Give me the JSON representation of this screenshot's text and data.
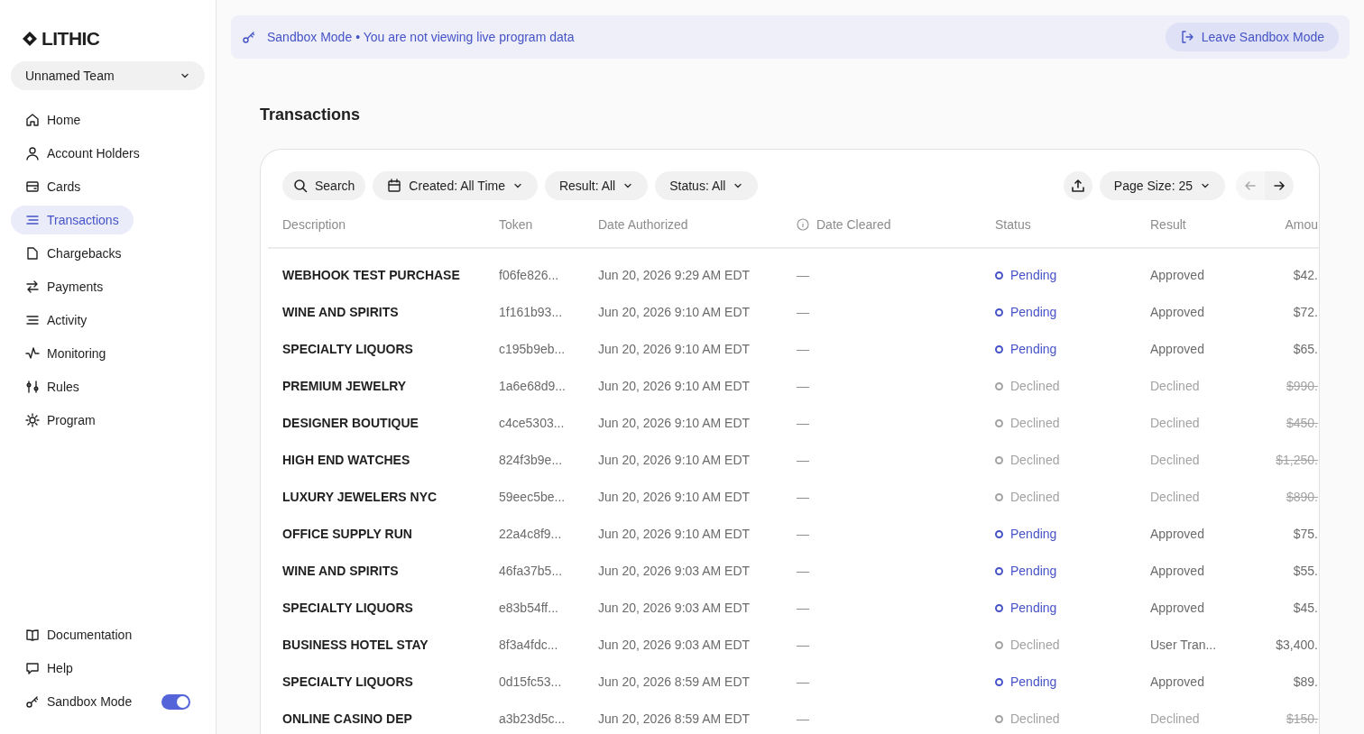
{
  "sidebar": {
    "logo": "LITHIC",
    "team": "Unnamed Team",
    "items": [
      {
        "label": "Home",
        "selected": false
      },
      {
        "label": "Account Holders",
        "selected": false
      },
      {
        "label": "Cards",
        "selected": false
      },
      {
        "label": "Transactions",
        "selected": true
      },
      {
        "label": "Chargebacks",
        "selected": false
      },
      {
        "label": "Payments",
        "selected": false
      },
      {
        "label": "Activity",
        "selected": false
      },
      {
        "label": "Monitoring",
        "selected": false
      },
      {
        "label": "Rules",
        "selected": false
      },
      {
        "label": "Program",
        "selected": false
      }
    ],
    "footer": [
      {
        "kind": "link",
        "label": "Documentation"
      },
      {
        "kind": "link",
        "label": "Help"
      },
      {
        "kind": "toggle",
        "label": "Sandbox Mode",
        "on": true
      }
    ]
  },
  "banner": {
    "title": "Sandbox Mode",
    "message": "• You are not viewing live program data",
    "button": "Leave Sandbox Mode"
  },
  "page_title": "Transactions",
  "toolbar": {
    "search": "Search",
    "filters": [
      "Created: All Time",
      "Result: All",
      "Status: All"
    ],
    "page_size": "Page Size: 25"
  },
  "table": {
    "columns": [
      "Description",
      "Token",
      "Date Authorized",
      "Date Cleared",
      "Status",
      "Result",
      "Amou"
    ],
    "rows": [
      {
        "description": "WEBHOOK TEST PURCHASE",
        "token": "f06fe826...",
        "date_authorized": "Jun 20, 2026 9:29 AM EDT",
        "date_cleared": "—",
        "status": "Pending",
        "kind": "pending",
        "result": "Approved",
        "amount": "$42.",
        "voided": false
      },
      {
        "description": "WINE AND SPIRITS",
        "token": "1f161b93...",
        "date_authorized": "Jun 20, 2026 9:10 AM EDT",
        "date_cleared": "—",
        "status": "Pending",
        "kind": "pending",
        "result": "Approved",
        "amount": "$72.",
        "voided": false
      },
      {
        "description": "SPECIALTY LIQUORS",
        "token": "c195b9eb...",
        "date_authorized": "Jun 20, 2026 9:10 AM EDT",
        "date_cleared": "—",
        "status": "Pending",
        "kind": "pending",
        "result": "Approved",
        "amount": "$65.",
        "voided": false
      },
      {
        "description": "PREMIUM JEWELRY",
        "token": "1a6e68d9...",
        "date_authorized": "Jun 20, 2026 9:10 AM EDT",
        "date_cleared": "—",
        "status": "Declined",
        "kind": "declined",
        "result": "Declined",
        "amount": "$990.",
        "voided": true
      },
      {
        "description": "DESIGNER BOUTIQUE",
        "token": "c4ce5303...",
        "date_authorized": "Jun 20, 2026 9:10 AM EDT",
        "date_cleared": "—",
        "status": "Declined",
        "kind": "declined",
        "result": "Declined",
        "amount": "$450.",
        "voided": true
      },
      {
        "description": "HIGH END WATCHES",
        "token": "824f3b9e...",
        "date_authorized": "Jun 20, 2026 9:10 AM EDT",
        "date_cleared": "—",
        "status": "Declined",
        "kind": "declined",
        "result": "Declined",
        "amount": "$1,250.",
        "voided": true
      },
      {
        "description": "LUXURY JEWELERS NYC",
        "token": "59eec5be...",
        "date_authorized": "Jun 20, 2026 9:10 AM EDT",
        "date_cleared": "—",
        "status": "Declined",
        "kind": "declined",
        "result": "Declined",
        "amount": "$890.",
        "voided": true
      },
      {
        "description": "OFFICE SUPPLY RUN",
        "token": "22a4c8f9...",
        "date_authorized": "Jun 20, 2026 9:10 AM EDT",
        "date_cleared": "—",
        "status": "Pending",
        "kind": "pending",
        "result": "Approved",
        "amount": "$75.",
        "voided": false
      },
      {
        "description": "WINE AND SPIRITS",
        "token": "46fa37b5...",
        "date_authorized": "Jun 20, 2026 9:03 AM EDT",
        "date_cleared": "—",
        "status": "Pending",
        "kind": "pending",
        "result": "Approved",
        "amount": "$55.",
        "voided": false
      },
      {
        "description": "SPECIALTY LIQUORS",
        "token": "e83b54ff...",
        "date_authorized": "Jun 20, 2026 9:03 AM EDT",
        "date_cleared": "—",
        "status": "Pending",
        "kind": "pending",
        "result": "Approved",
        "amount": "$45.",
        "voided": false
      },
      {
        "description": "BUSINESS HOTEL STAY",
        "token": "8f3a4fdc...",
        "date_authorized": "Jun 20, 2026 9:03 AM EDT",
        "date_cleared": "—",
        "status": "Declined",
        "kind": "declined",
        "result": "User Tran...",
        "amount": "$3,400.",
        "voided": false
      },
      {
        "description": "SPECIALTY LIQUORS",
        "token": "0d15fc53...",
        "date_authorized": "Jun 20, 2026 8:59 AM EDT",
        "date_cleared": "—",
        "status": "Pending",
        "kind": "pending",
        "result": "Approved",
        "amount": "$89.",
        "voided": false
      },
      {
        "description": "ONLINE CASINO DEP",
        "token": "a3b23d5c...",
        "date_authorized": "Jun 20, 2026 8:59 AM EDT",
        "date_cleared": "—",
        "status": "Declined",
        "kind": "declined",
        "result": "Declined",
        "amount": "$150.",
        "voided": true
      }
    ]
  }
}
